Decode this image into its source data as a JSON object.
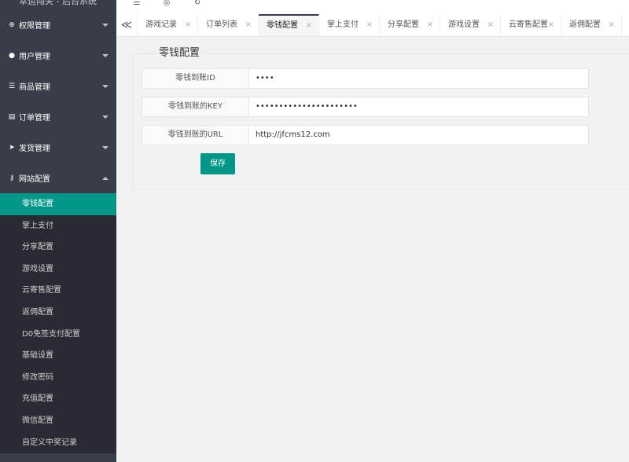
{
  "sidebar": {
    "title": "幸运闯关 - 后台系统",
    "groups": [
      {
        "label": "权限管理",
        "icon": "globe-icon"
      },
      {
        "label": "用户管理",
        "icon": "user-icon"
      },
      {
        "label": "商品管理",
        "icon": "list-icon"
      },
      {
        "label": "订单管理",
        "icon": "card-icon"
      },
      {
        "label": "发货管理",
        "icon": "rocket-icon"
      },
      {
        "label": "网站配置",
        "icon": "key-icon"
      }
    ],
    "sub_items": [
      "零钱配置",
      "掌上支付",
      "分享配置",
      "游戏设置",
      "云寄售配置",
      "返佣配置",
      "D0免签支付配置",
      "基础设置",
      "修改密码",
      "充值配置",
      "微信配置",
      "自定义中奖记录"
    ]
  },
  "topbar": {
    "icons": [
      "menu-toggle-icon",
      "theme-icon",
      "refresh-icon"
    ]
  },
  "tabs": {
    "nav_symbol": "≪",
    "close_symbol": "×",
    "items": [
      "游戏记录",
      "订单列表",
      "零钱配置",
      "掌上支付",
      "分享配置",
      "游戏设置",
      "云寄售配置",
      "返佣配置"
    ]
  },
  "form": {
    "legend": "零钱配置",
    "fields": [
      {
        "label": "零钱到账ID",
        "value": "••••"
      },
      {
        "label": "零钱到账的KEY",
        "value": "••••••••••••••••••••••"
      },
      {
        "label": "零钱到账的URL",
        "value": "http://jfcms12.com"
      }
    ],
    "save_label": "保存"
  },
  "colors": {
    "sidebar_bg": "#393d49",
    "subnav_bg": "#282b33",
    "accent": "#009688"
  }
}
